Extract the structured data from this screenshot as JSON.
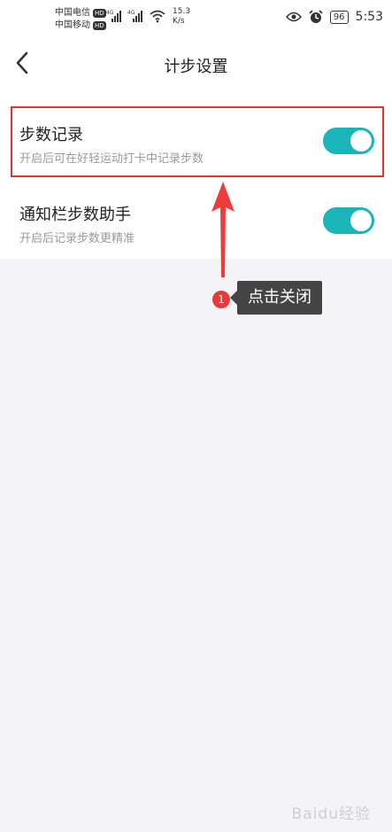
{
  "status": {
    "carrier1": "中国电信",
    "carrier2": "中国移动",
    "hd_label": "HD",
    "network": "4G",
    "speed_value": "15.3",
    "speed_unit": "K/s",
    "battery": "96",
    "time": "5:53"
  },
  "header": {
    "title": "计步设置"
  },
  "settings": [
    {
      "label": "步数记录",
      "desc": "开启后可在好轻运动打卡中记录步数",
      "enabled": true
    },
    {
      "label": "通知栏步数助手",
      "desc": "开启后记录步数更精准",
      "enabled": true
    }
  ],
  "annotation": {
    "step_number": "1",
    "text": "点击关闭"
  },
  "colors": {
    "toggle_on": "#19b5b8",
    "highlight": "#e6312d",
    "tooltip_bg": "#444444"
  },
  "watermark": "Baidu经验"
}
